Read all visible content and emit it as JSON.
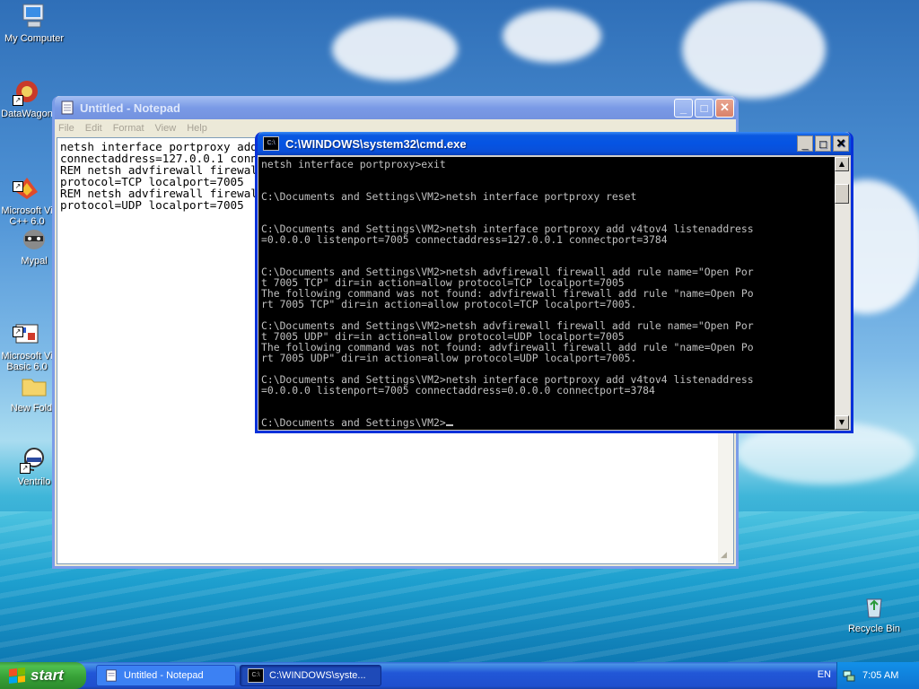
{
  "desktop": {
    "icons": [
      {
        "label": "My Computer"
      },
      {
        "label": "DataWagon"
      },
      {
        "label": "Microsoft Vi\nC++ 6.0"
      },
      {
        "label": "Mypal"
      },
      {
        "label": "Microsoft Vi\nBasic 6.0"
      },
      {
        "label": "New Folde"
      },
      {
        "label": "Ventrilo"
      },
      {
        "label": "Recycle Bin"
      }
    ]
  },
  "notepad": {
    "title": "Untitled - Notepad",
    "menu": [
      "File",
      "Edit",
      "Format",
      "View",
      "Help"
    ],
    "text": "netsh interface portproxy add v4tov4 listenaddress=0.0.0.0 listenport=7005\nconnectaddress=127.0.0.1 connectport=3784\nREM netsh advfirewall firewall add rule name=\"Open Port 7005 TCP\" dir=in action=allow\nprotocol=TCP localport=7005\nREM netsh advfirewall firewall add rule name=\"Open Port 7005 UDP\" dir=in action=allow\nprotocol=UDP localport=7005"
  },
  "cmd": {
    "title": "C:\\WINDOWS\\system32\\cmd.exe",
    "icon_text": "C:\\",
    "output": "netsh interface portproxy>exit\n\n\nC:\\Documents and Settings\\VM2>netsh interface portproxy reset\n\n\nC:\\Documents and Settings\\VM2>netsh interface portproxy add v4tov4 listenaddress\n=0.0.0.0 listenport=7005 connectaddress=127.0.0.1 connectport=3784\n\n\nC:\\Documents and Settings\\VM2>netsh advfirewall firewall add rule name=\"Open Por\nt 7005 TCP\" dir=in action=allow protocol=TCP localport=7005\nThe following command was not found: advfirewall firewall add rule \"name=Open Po\nrt 7005 TCP\" dir=in action=allow protocol=TCP localport=7005.\n\nC:\\Documents and Settings\\VM2>netsh advfirewall firewall add rule name=\"Open Por\nt 7005 UDP\" dir=in action=allow protocol=UDP localport=7005\nThe following command was not found: advfirewall firewall add rule \"name=Open Po\nrt 7005 UDP\" dir=in action=allow protocol=UDP localport=7005.\n\nC:\\Documents and Settings\\VM2>netsh interface portproxy add v4tov4 listenaddress\n=0.0.0.0 listenport=7005 connectaddress=0.0.0.0 connectport=3784\n\n\nC:\\Documents and Settings\\VM2>"
  },
  "taskbar": {
    "start_label": "start",
    "tasks": [
      {
        "label": "Untitled - Notepad"
      },
      {
        "label": "C:\\WINDOWS\\syste..."
      }
    ],
    "language": "EN",
    "clock": "7:05 AM"
  },
  "colors": {
    "title_active": "#0554e3",
    "start_green": "#37a137",
    "console_text": "#c0c0c0"
  }
}
